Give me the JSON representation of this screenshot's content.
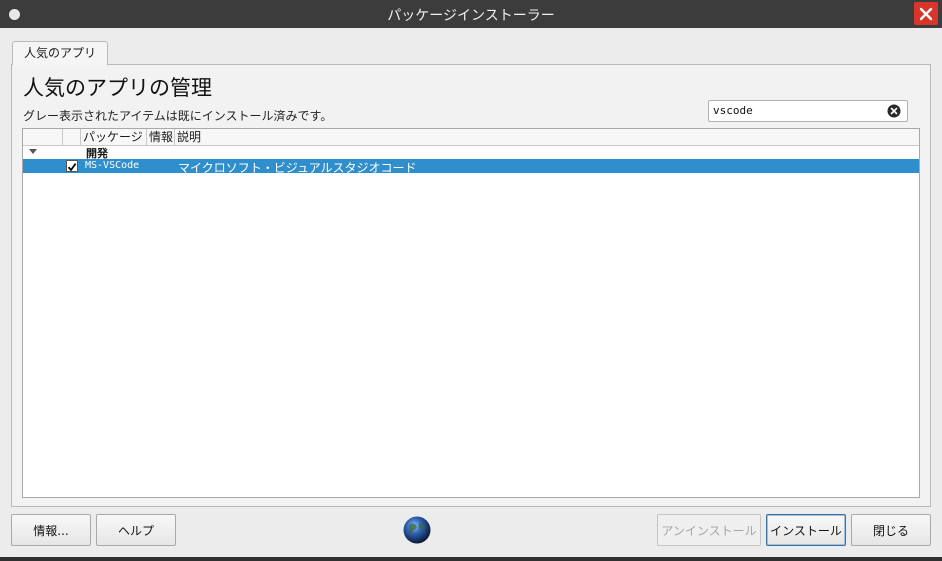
{
  "window": {
    "title": "パッケージインストーラー"
  },
  "tabs": [
    {
      "label": "人気のアプリ"
    }
  ],
  "main": {
    "heading": "人気のアプリの管理",
    "subtext": "グレー表示されたアイテムは既にインストール済みです。"
  },
  "search": {
    "value": "vscode"
  },
  "table": {
    "columns": [
      "",
      "",
      "パッケージ",
      "情報",
      "説明"
    ],
    "groups": [
      {
        "label": "開発",
        "expanded": true,
        "items": [
          {
            "checked": true,
            "selected": true,
            "package": "MS-VSCode",
            "description": "マイクロソフト・ビジュアルスタジオコード"
          }
        ]
      }
    ]
  },
  "buttons": {
    "info": "情報...",
    "help": "ヘルプ",
    "uninstall": "アンインストール",
    "install": "インストール",
    "close": "閉じる"
  },
  "colors": {
    "selection": "#2f8fcc",
    "close_button": "#d8362b",
    "titlebar": "#3c3c3c"
  },
  "icons": {
    "window_close": "close-icon",
    "search_clear": "clear-search-icon",
    "logo": "globe-icon",
    "expander": "chevron-down-icon",
    "check": "checkmark-icon"
  }
}
